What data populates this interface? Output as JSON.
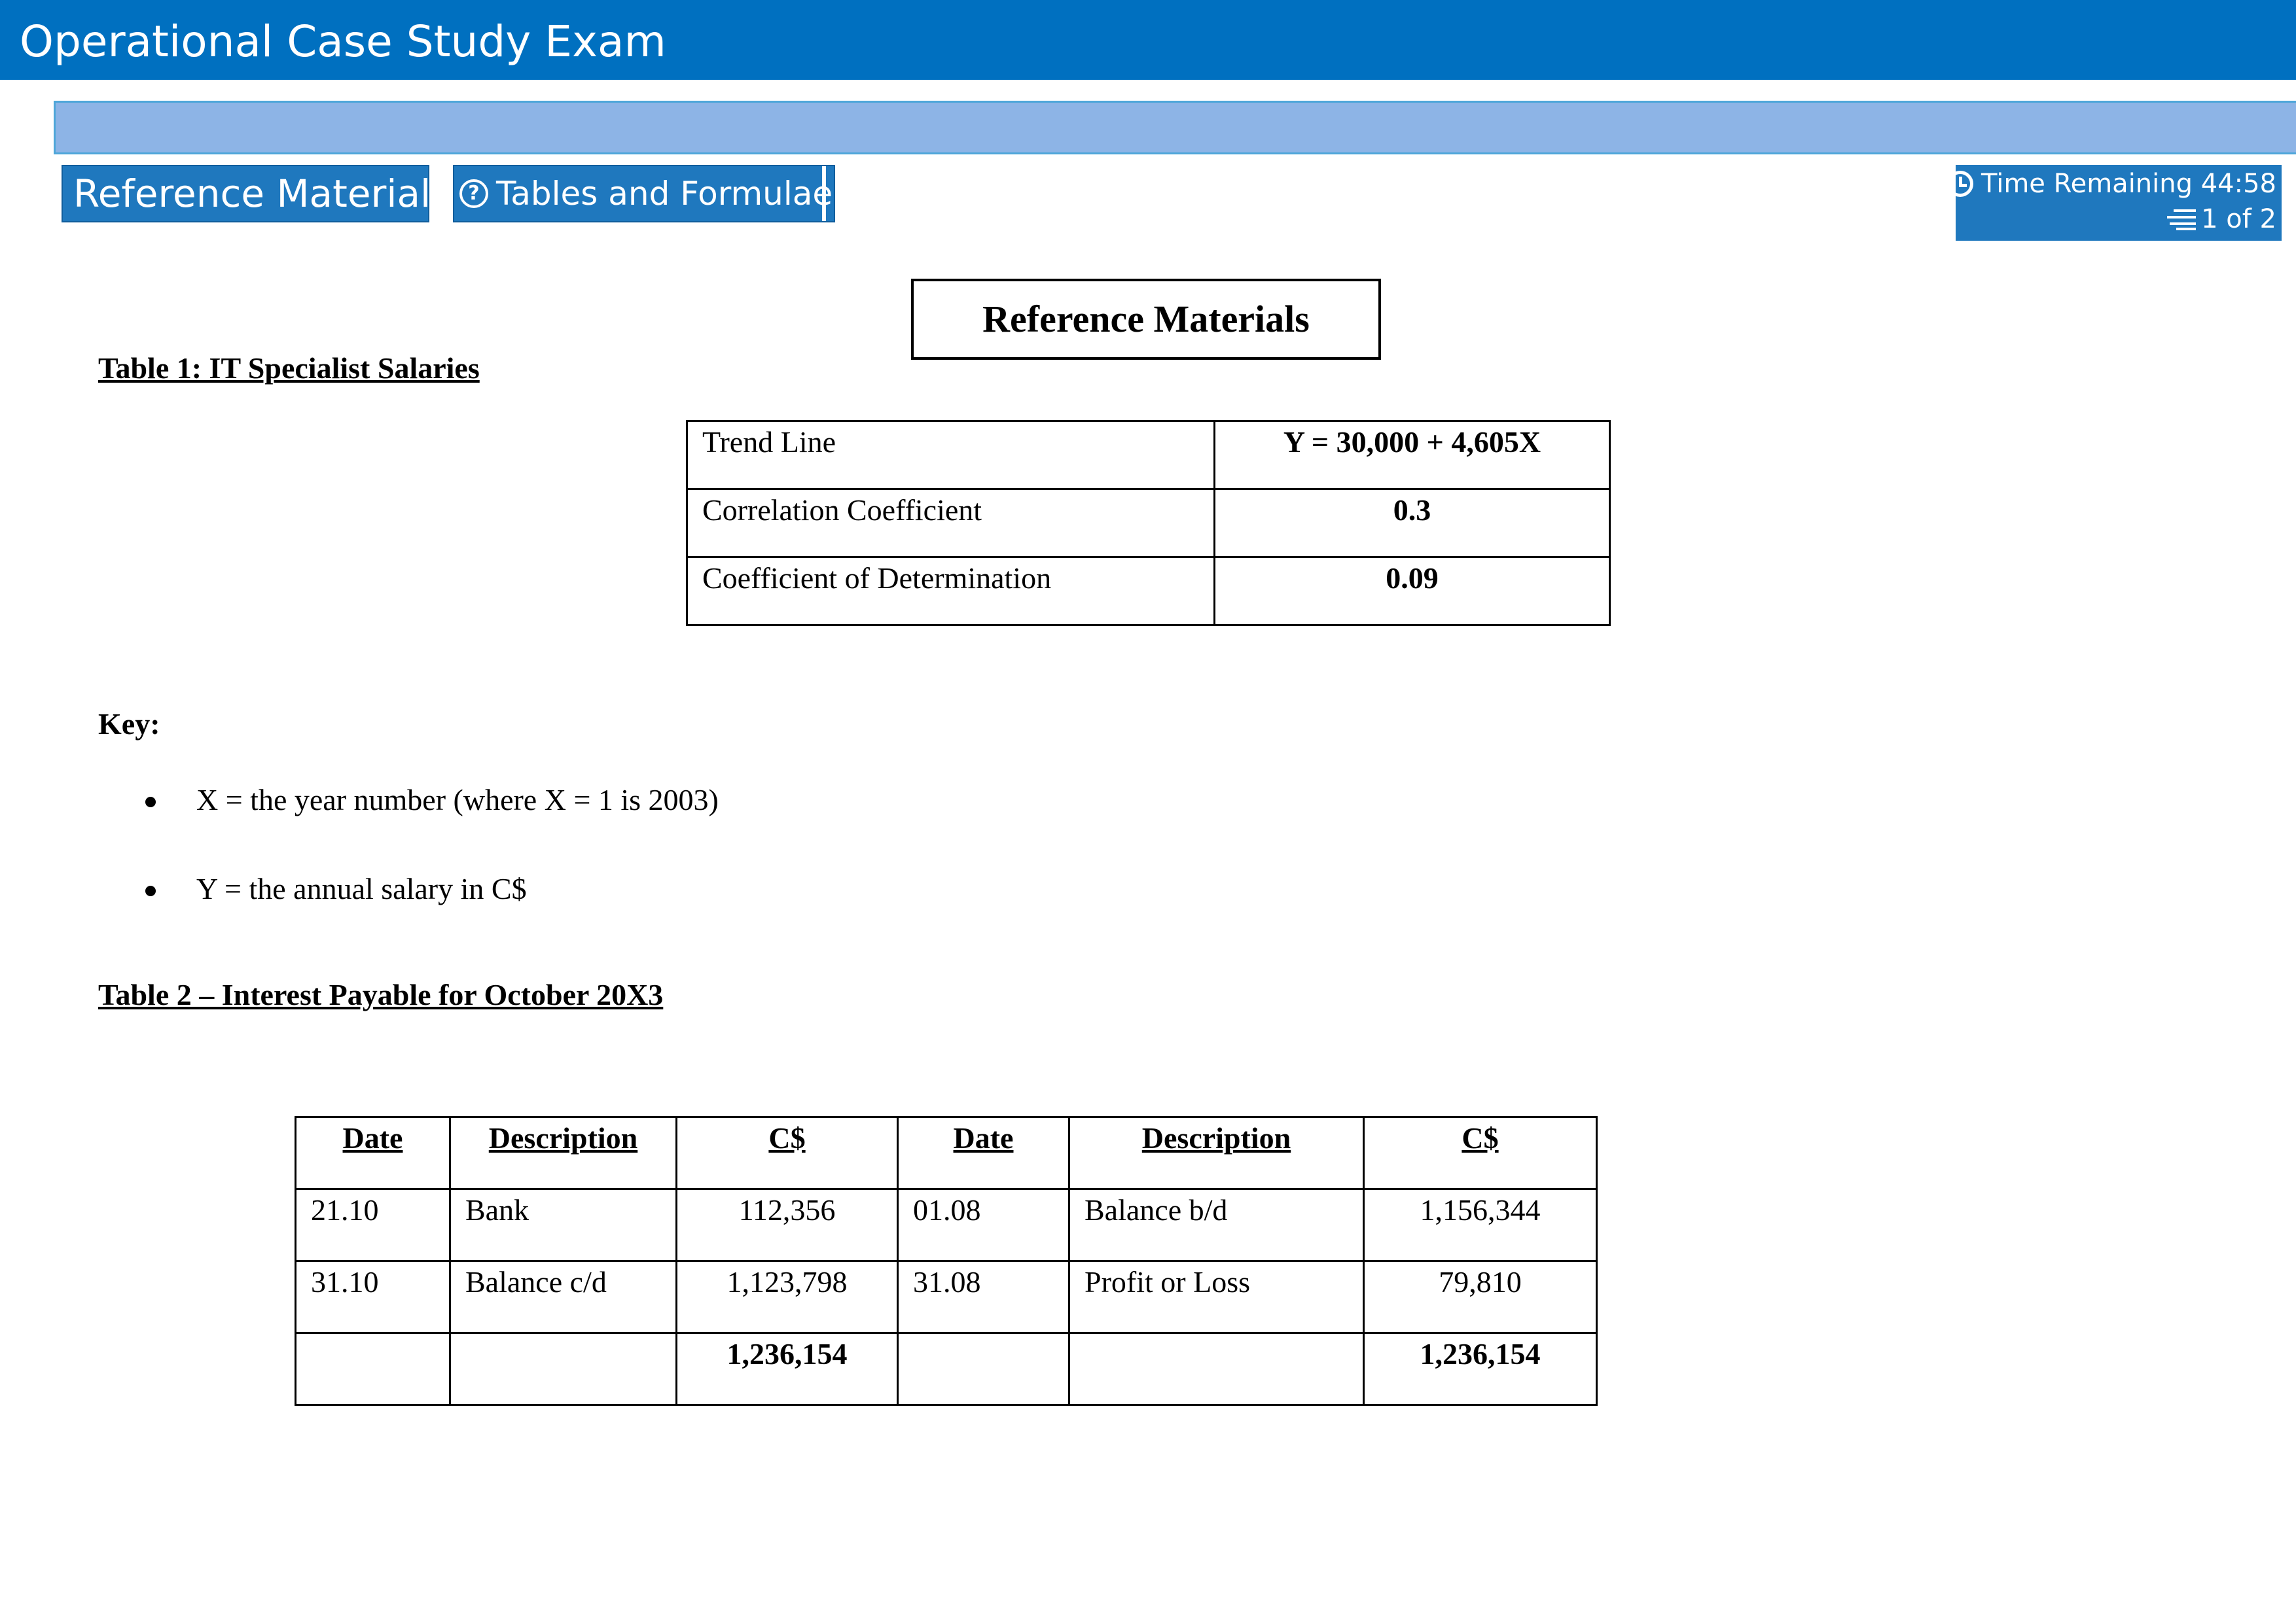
{
  "header": {
    "title": "Operational Case Study Exam"
  },
  "tabs": {
    "reference_material": "Reference Material",
    "tables_and_formulae": "Tables and Formulae"
  },
  "status": {
    "time_remaining": "Time Remaining 44:58",
    "page": "1 of 2"
  },
  "document": {
    "heading": "Reference Materials",
    "table1": {
      "title": "Table 1: IT Specialist Salaries",
      "rows": [
        {
          "label": "Trend Line",
          "value": "Y = 30,000 + 4,605X"
        },
        {
          "label": "Correlation Coefficient",
          "value": "0.3"
        },
        {
          "label": "Coefficient of Determination",
          "value": "0.09"
        }
      ]
    },
    "key": {
      "label": "Key:",
      "items": [
        "X = the year number (where X = 1 is 2003)",
        "Y = the annual salary in C$"
      ]
    },
    "table2": {
      "title": "Table 2 – Interest Payable for October 20X3",
      "headers": [
        "Date",
        "Description",
        "C$",
        "Date",
        "Description",
        "C$"
      ],
      "rows": [
        [
          "21.10",
          "Bank",
          "112,356",
          "01.08",
          "Balance b/d",
          "1,156,344"
        ],
        [
          "31.10",
          "Balance c/d",
          "1,123,798",
          "31.08",
          "Profit or Loss",
          "79,810"
        ],
        [
          "",
          "",
          "1,236,154",
          "",
          "",
          "1,236,154"
        ]
      ]
    }
  },
  "icons": {
    "help": "question-circle-icon",
    "clock": "clock-icon",
    "pages": "pages-icon"
  },
  "colors": {
    "header_blue": "#0070c0",
    "band_blue": "#8db4e6",
    "tab_blue": "#1f78be"
  }
}
